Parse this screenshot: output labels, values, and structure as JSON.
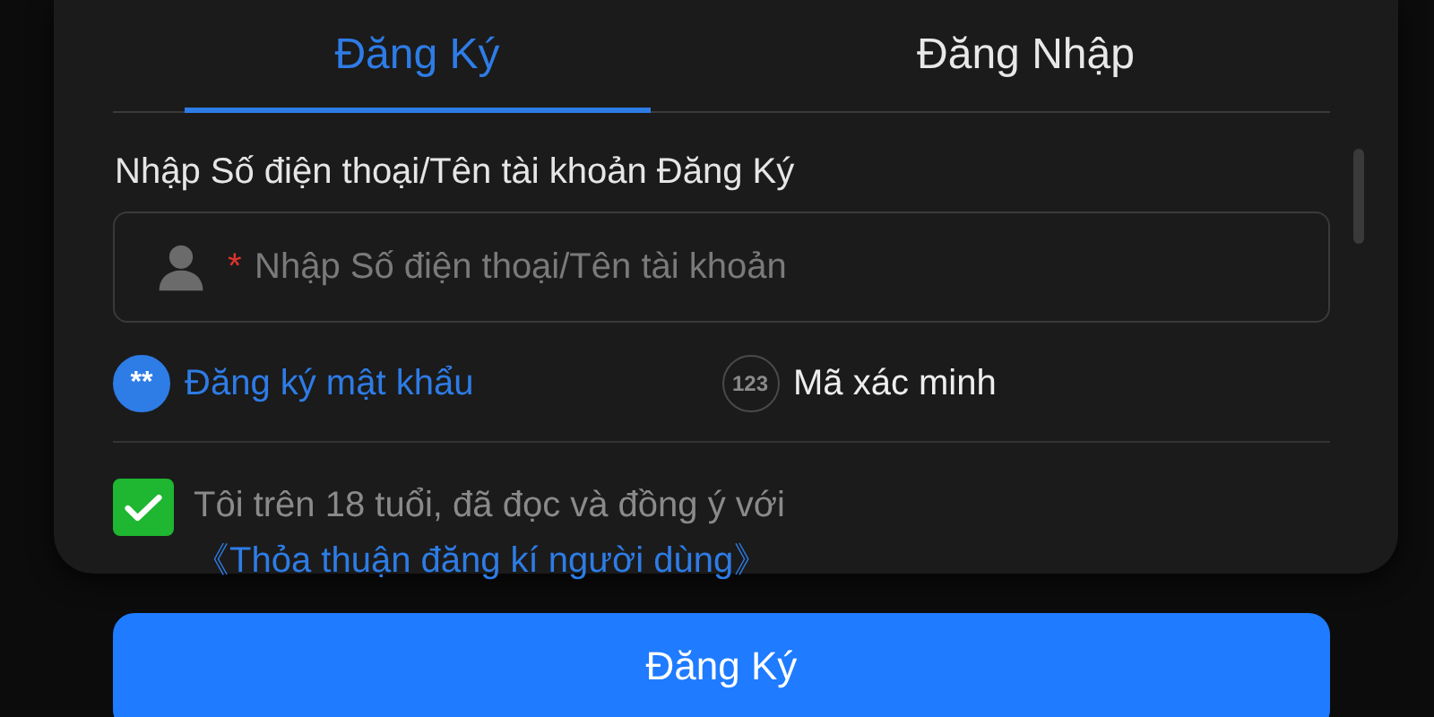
{
  "tabs": [
    {
      "label": "Đăng Ký",
      "selected": true
    },
    {
      "label": "Đăng Nhập",
      "selected": false
    }
  ],
  "account_field": {
    "label": "Nhập Số điện thoại/Tên tài khoản Đăng Ký",
    "required_mark": "*",
    "placeholder": "Nhập Số điện thoại/Tên tài khoản"
  },
  "modes": [
    {
      "badge": "**",
      "label": "Đăng ký mật khẩu",
      "selected": true
    },
    {
      "badge": "123",
      "label": "Mã xác minh",
      "selected": false
    }
  ],
  "agreement": {
    "checked": true,
    "text": "Tôi trên 18 tuổi, đã đọc và đồng ý với",
    "link": "《Thỏa thuận đăng kí người dùng》"
  },
  "submit_button": "Đăng Ký"
}
